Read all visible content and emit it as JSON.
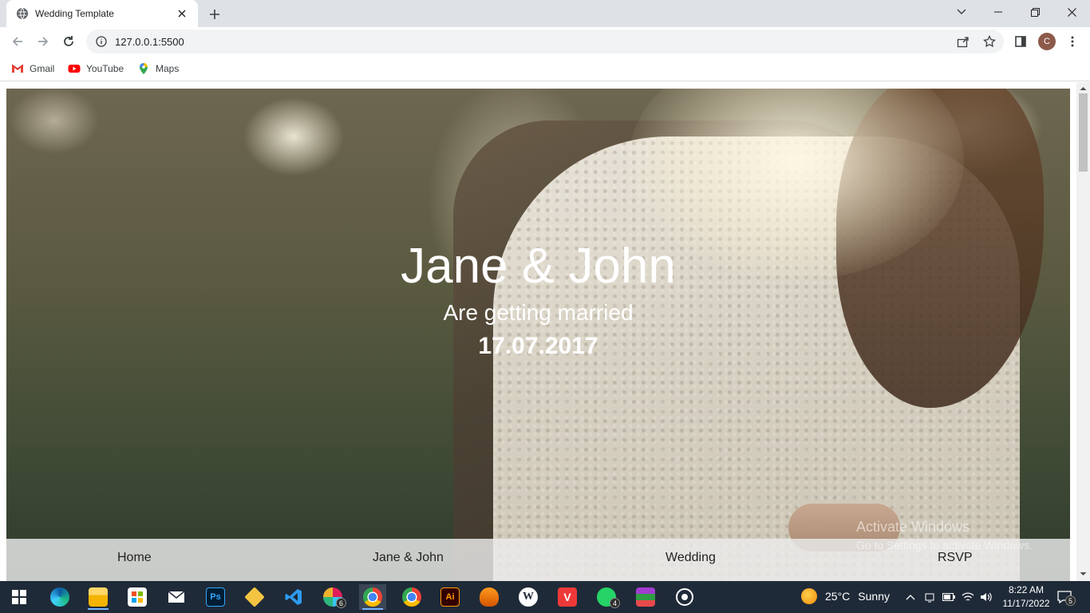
{
  "browser": {
    "tab_title": "Wedding Template",
    "url": "127.0.0.1:5500",
    "profile_initial": "C",
    "bookmarks": [
      {
        "label": "Gmail",
        "icon": "gmail-icon"
      },
      {
        "label": "YouTube",
        "icon": "youtube-icon"
      },
      {
        "label": "Maps",
        "icon": "maps-icon"
      }
    ]
  },
  "hero": {
    "title": "Jane & John",
    "subtitle": "Are getting married",
    "date": "17.07.2017"
  },
  "nav": {
    "items": [
      "Home",
      "Jane & John",
      "Wedding",
      "RSVP"
    ]
  },
  "watermark": {
    "title": "Activate Windows",
    "subtitle": "Go to Settings to activate Windows."
  },
  "taskbar": {
    "apps": [
      {
        "name": "start-icon"
      },
      {
        "name": "edge-icon"
      },
      {
        "name": "file-explorer-icon"
      },
      {
        "name": "microsoft-store-icon"
      },
      {
        "name": "mail-icon"
      },
      {
        "name": "photoshop-icon",
        "label": "Ps"
      },
      {
        "name": "git-icon"
      },
      {
        "name": "vscode-icon"
      },
      {
        "name": "slack-icon",
        "badge": "6"
      },
      {
        "name": "chrome-icon",
        "active": true
      },
      {
        "name": "chrome-profile-icon"
      },
      {
        "name": "illustrator-icon",
        "label": "Ai"
      },
      {
        "name": "fl-studio-icon"
      },
      {
        "name": "wordpress-icon"
      },
      {
        "name": "vivaldi-icon"
      },
      {
        "name": "whatsapp-icon",
        "badge": "4"
      },
      {
        "name": "winrar-icon"
      },
      {
        "name": "obs-icon"
      }
    ],
    "weather": {
      "temp": "25°C",
      "condition": "Sunny"
    },
    "time": "8:22 AM",
    "date": "11/17/2022",
    "notifications": "5"
  },
  "colors": {
    "tabstrip": "#dee1e6",
    "taskbar": "#1f2a38",
    "nav_bar": "#ebebeb",
    "hero_text": "#ffffff"
  }
}
